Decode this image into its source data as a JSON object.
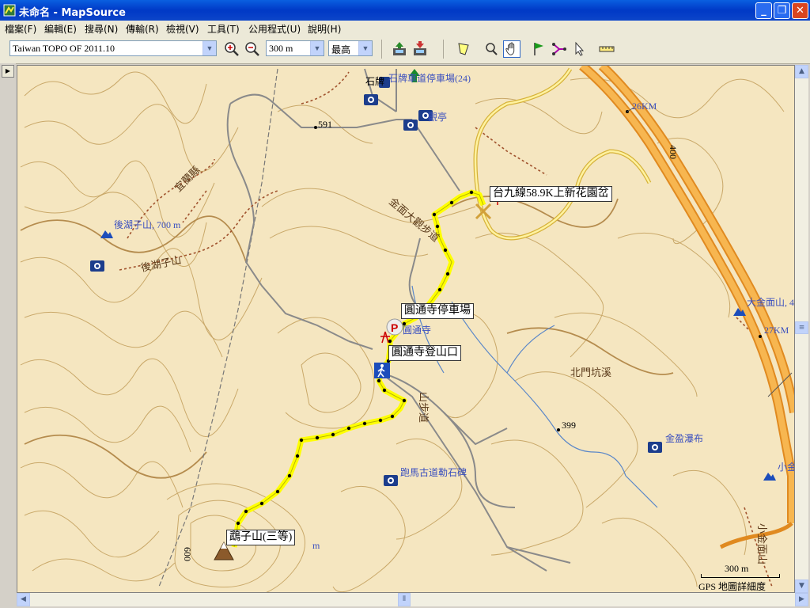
{
  "window": {
    "title": "未命名 - MapSource"
  },
  "menu": [
    "檔案(F)",
    "編輯(E)",
    "搜尋(N)",
    "傳輸(R)",
    "檢視(V)",
    "工具(T)",
    "公用程式(U)",
    "說明(H)"
  ],
  "toolbar": {
    "map_product": "Taiwan TOPO OF 2011.10",
    "zoom_scale": "300 m",
    "detail": "最高"
  },
  "map": {
    "text_labels": {
      "parking_top": "石牌車道停車場(24)",
      "shi_label": "石牌",
      "guan_ting": "觀亭",
      "elev_591": "591",
      "elev_399": "399",
      "elev_400": "400",
      "elev_600": "600",
      "km26": "26KM",
      "km27": "27KM",
      "hu_zi_shan_peak": "後湖子山, 700 m",
      "hu_zi_shan": "後湖子山",
      "trail_yilan": "宜蘭縣",
      "trail_jinmian": "金面大觀步道",
      "yuantong_temple": "圓通寺",
      "beimen_creek": "北門坑溪",
      "jinsheng_falls": "金盈瀑布",
      "paoma_stone": "跑馬古道勒石碑",
      "dajinmian": "大金面山, 4",
      "xiaojin": "小金",
      "xiaojinmian_road": "小金面山",
      "wu_road": "山步道",
      "ying_suffix": "m"
    },
    "waypoints": {
      "provincial_road": "台九線58.9K上新花園岔",
      "yuantong_parking": "圓通寺停車場",
      "yuantong_trailhead": "圓通寺登山口",
      "yingge_peak": "鵡子山(三等)"
    },
    "scale": {
      "value": "300 m",
      "detail_label": "GPS 地圖詳細度"
    }
  },
  "colors": {
    "map_bg": "#f5e6c0",
    "contour": "#c9a869",
    "track": "#ffff00",
    "highway": "#f0a830",
    "trail": "#a0522d"
  }
}
